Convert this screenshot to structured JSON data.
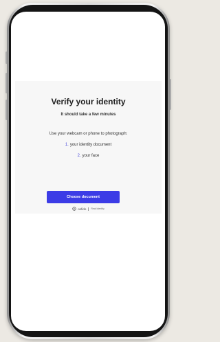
{
  "verify": {
    "title": "Verify your identity",
    "subtitle": "It should take a few minutes",
    "instruction": "Use your webcam or phone to photograph:",
    "steps": [
      {
        "number": "1.",
        "label": "your identity document"
      },
      {
        "number": "2.",
        "label": "your face"
      }
    ],
    "primary_button": "Choose document"
  },
  "footer": {
    "brand": "onfido",
    "tagline": "Real Identity",
    "logo_icon": "onfido-logo-icon"
  },
  "colors": {
    "accent": "#3c3ce6",
    "step_number": "#4a4adb",
    "page_background": "#ece9e3"
  }
}
